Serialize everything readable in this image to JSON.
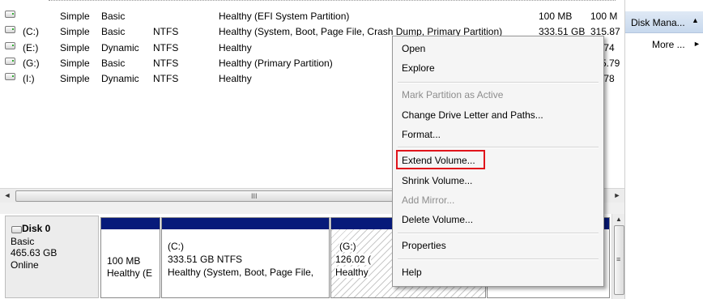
{
  "volumes": [
    {
      "drive": "",
      "layout": "Simple",
      "type": "Basic",
      "fs": "",
      "status": "Healthy (EFI System Partition)",
      "capacity": "100 MB",
      "free": "100 M"
    },
    {
      "drive": "(C:)",
      "layout": "Simple",
      "type": "Basic",
      "fs": "NTFS",
      "status": "Healthy (System, Boot, Page File, Crash Dump, Primary Partition)",
      "capacity": "333.51 GB",
      "free": "315.87"
    },
    {
      "drive": "(E:)",
      "layout": "Simple",
      "type": "Dynamic",
      "fs": "NTFS",
      "status": "Healthy",
      "capacity": "",
      "free": ".74"
    },
    {
      "drive": "(G:)",
      "layout": "Simple",
      "type": "Basic",
      "fs": "NTFS",
      "status": "Healthy (Primary Partition)",
      "capacity": "",
      "free": "5.79"
    },
    {
      "drive": "(I:)",
      "layout": "Simple",
      "type": "Dynamic",
      "fs": "NTFS",
      "status": "Healthy",
      "capacity": "",
      "free": ".78"
    }
  ],
  "scrollbar": {
    "left_arrow": "◄",
    "grip": "III",
    "right_arrow": "►",
    "up_arrow": "▲",
    "v_grip": "≡"
  },
  "disk0": {
    "name": "Disk 0",
    "type": "Basic",
    "size": "465.63 GB",
    "state": "Online",
    "partitions": [
      {
        "title": "",
        "size": "100 MB",
        "status": "Healthy (E"
      },
      {
        "title": "(C:)",
        "size": "333.51 GB NTFS",
        "status": "Healthy (System, Boot, Page File,"
      },
      {
        "title": "(G:)",
        "size": "126.02 (",
        "status": "Healthy"
      }
    ]
  },
  "actions": {
    "title": "Disk Mana...",
    "collapse_arrow": "▲",
    "more": "More ...",
    "more_arrow": "►"
  },
  "context_menu": {
    "open": "Open",
    "explore": "Explore",
    "mark_active": "Mark Partition as Active",
    "change_letter": "Change Drive Letter and Paths...",
    "format": "Format...",
    "extend": "Extend Volume...",
    "shrink": "Shrink Volume...",
    "add_mirror": "Add Mirror...",
    "delete": "Delete Volume...",
    "properties": "Properties",
    "help": "Help"
  },
  "colors": {
    "partition_band": "#071a7a",
    "highlight_box": "#e0141b"
  }
}
